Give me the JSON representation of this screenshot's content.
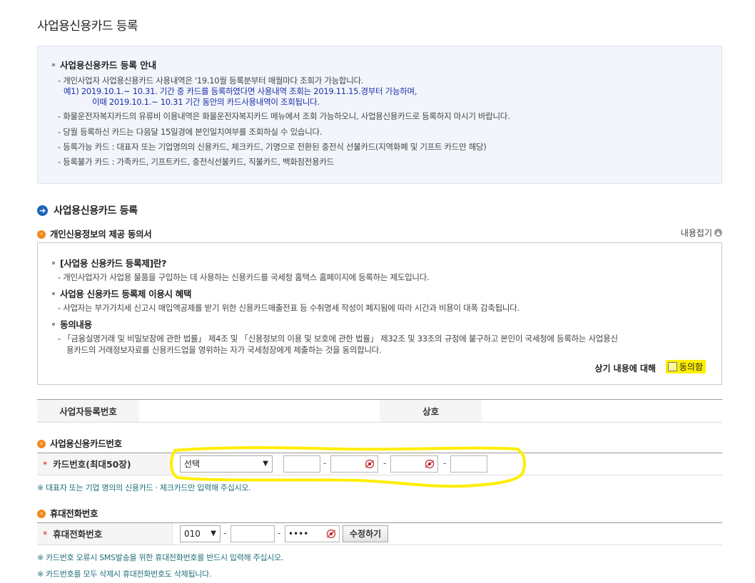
{
  "page_title": "사업용신용카드 등록",
  "guide": {
    "title": "사업용신용카드 등록 안내",
    "lines": [
      "- 개인사업자 사업용신용카드 사용내역은 '19.10월 등록분부터 매월마다 조회가 가능합니다.",
      "예1) 2019.10.1.~ 10.31. 기간 중 카드를 등록하였다면 사용내역 조회는 2019.11.15.경부터 가능하며,",
      "이때 2019.10.1.~ 10.31 기간 동안의 카드사용내역이 조회됩니다.",
      "- 화물운전자복지카드의 유류비 이용내역은 화물운전자복지카드 메뉴에서 조회 가능하오니, 사업용신용카드로 등록하지 마시기 바랍니다.",
      "- 당월 등록하신 카드는 다음달 15일경에 본인일치여부를 조회하실 수 있습니다.",
      "- 등록가능 카드 : 대표자 또는 기업명의의 신용카드, 체크카드, 기명으로 전환된 충전식 선불카드(지역화폐 및 기프트 카드만 해당)",
      "- 등록불가 카드 : 가족카드, 기프트카드, 충전식선불카드, 직불카드, 백화점전용카드"
    ]
  },
  "section_title": "사업용신용카드 등록",
  "consent": {
    "title": "개인신용정보의 제공 동의서",
    "collapse_label": "내용접기",
    "h1": "[사업용 신용카드 등록제]란?",
    "l1": "- 개인사업자가 사업용 물품을 구입하는 데 사용하는 신용카드를 국세청 홈택스 홈페이지에 등록하는 제도입니다.",
    "h2": "사업용 신용카드 등록제 이용시 혜택",
    "l2": "- 사업자는 부가가치세 신고시 매입액공제를 받기 위한 신용카드매출전표 등 수취명세 작성이 폐지됨에 따라 시간과 비용이 대폭 감축됩니다.",
    "h3": "동의내용",
    "l3a": "- 「금융실명거래 및 비밀보장에 관한 법률」 제4조 및 「신용정보의 이용 및 보호에 관한 법률」 제32조 및 33조의 규정에 불구하고 본인이 국세청에 등록하는 사업용신",
    "l3b": "용카드의    거래정보자료를 신용카드업을 영위하는 자가 국세청장에게 제출하는 것을 동의합니다.",
    "agree_label": "상기 내용에 대해",
    "agree_check": "동의함"
  },
  "info_table": {
    "biz_no_label": "사업자등록번호",
    "biz_no_value": "",
    "company_label": "상호",
    "company_value": ""
  },
  "card": {
    "section": "사업용신용카드번호",
    "label": "카드번호(최대50장)",
    "select_value": "선택",
    "seg1": "",
    "seg2": "",
    "seg3": "",
    "seg4": "",
    "note": "※ 대표자 또는 기업 명의의 신용카드 · 체크카드만 입력해 주십시오."
  },
  "phone": {
    "section": "휴대전화번호",
    "label": "휴대전화번호",
    "prefix": "010",
    "middle": "",
    "last": "••••",
    "edit_button": "수정하기",
    "note1": "※ 카드번호 오류시 SMS발송을 위한 휴대전화번호를 반드시 입력해 주십시오.",
    "note2": "※ 카드번호를 모두 삭제시 휴대전화번호도 삭제됩니다."
  },
  "colors": {
    "highlight": "#ffee00",
    "note_text": "#1f6f7a",
    "guide_blue": "#1a2fa8",
    "section_icon": "#1e66b8",
    "sub_icon": "#f08a1c"
  }
}
